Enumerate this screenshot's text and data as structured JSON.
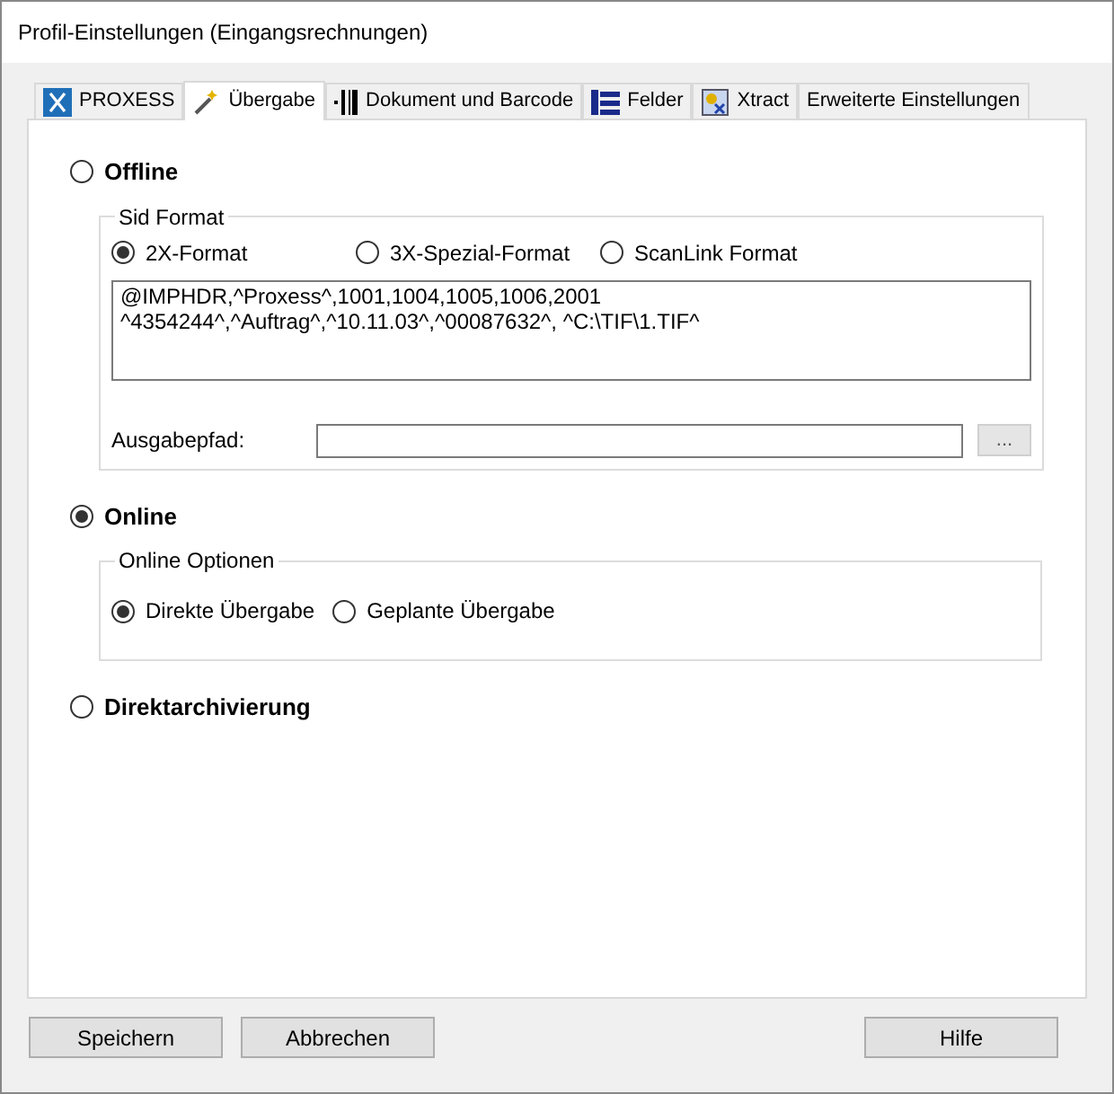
{
  "window": {
    "title": "Profil-Einstellungen (Eingangsrechnungen)"
  },
  "tabs": [
    {
      "label": "PROXESS",
      "kind": "proxess",
      "selected": false
    },
    {
      "label": "Übergabe",
      "kind": "wand",
      "selected": true
    },
    {
      "label": "Dokument und Barcode",
      "kind": "barcode",
      "selected": false
    },
    {
      "label": "Felder",
      "kind": "fields",
      "selected": false
    },
    {
      "label": "Xtract",
      "kind": "xtract",
      "selected": false
    },
    {
      "label": "Erweiterte Einstellungen",
      "kind": "plain",
      "selected": false
    }
  ],
  "offline": {
    "label": "Offline",
    "selected": false,
    "sid_format": {
      "title": "Sid Format",
      "options": [
        {
          "label": "2X-Format",
          "selected": true
        },
        {
          "label": "3X-Spezial-Format",
          "selected": false
        },
        {
          "label": "ScanLink Format",
          "selected": false
        }
      ],
      "preview": [
        "@IMPHDR,^Proxess^,1001,1004,1005,1006,2001",
        "^4354244^,^Auftrag^,^10.11.03^,^00087632^, ^C:\\TIF\\1.TIF^"
      ],
      "output_label": "Ausgabepfad:",
      "browse": "..."
    }
  },
  "online": {
    "label": "Online",
    "selected": true,
    "options_group": {
      "title": "Online Optionen",
      "options": [
        {
          "label": "Direkte Übergabe",
          "selected": true
        },
        {
          "label": "Geplante Übergabe",
          "selected": false
        }
      ]
    }
  },
  "direct_archiving": {
    "label": "Direktarchivierung",
    "selected": false
  },
  "buttons": [
    {
      "label": "Speichern"
    },
    {
      "label": "Abbrechen"
    },
    {
      "label": "Hilfe"
    }
  ]
}
